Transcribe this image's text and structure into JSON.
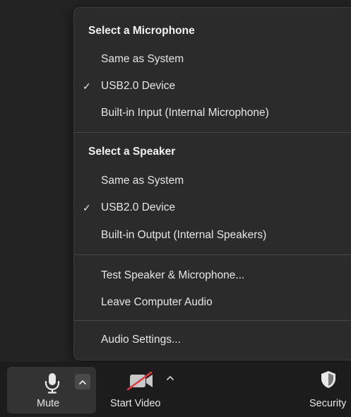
{
  "menu": {
    "microphone_title": "Select a Microphone",
    "microphone_items": [
      {
        "label": "Same as System",
        "checked": false
      },
      {
        "label": "USB2.0 Device",
        "checked": true
      },
      {
        "label": "Built-in Input (Internal Microphone)",
        "checked": false
      }
    ],
    "speaker_title": "Select a Speaker",
    "speaker_items": [
      {
        "label": "Same as System",
        "checked": false
      },
      {
        "label": "USB2.0 Device",
        "checked": true
      },
      {
        "label": "Built-in Output (Internal Speakers)",
        "checked": false
      }
    ],
    "test_label": "Test Speaker & Microphone...",
    "leave_label": "Leave Computer Audio",
    "settings_label": "Audio Settings...",
    "check_glyph": "✓"
  },
  "toolbar": {
    "mute_label": "Mute",
    "start_video_label": "Start Video",
    "security_label": "Security"
  },
  "icons": {
    "mic": "microphone-icon",
    "caret": "chevron-up-icon",
    "video": "video-off-icon",
    "shield": "shield-icon"
  },
  "colors": {
    "background": "#232323",
    "menu_bg": "#2b2b2b",
    "toolbar_bg": "#1c1c1c",
    "text": "#e6e6e6",
    "video_slash": "#e0393e"
  }
}
